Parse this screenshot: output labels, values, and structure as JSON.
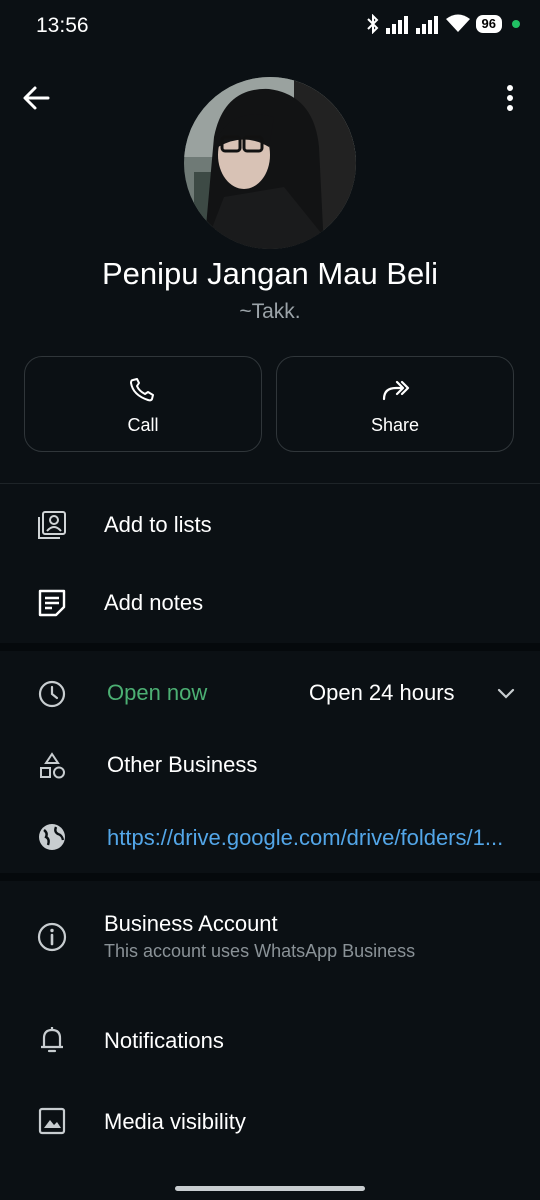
{
  "status_bar": {
    "time": "13:56",
    "battery": "96"
  },
  "profile": {
    "name": "Penipu Jangan Mau Beli",
    "about": "~Takk."
  },
  "actions": {
    "call_label": "Call",
    "share_label": "Share"
  },
  "menu": {
    "add_to_lists": "Add to lists",
    "add_notes": "Add notes"
  },
  "business": {
    "hours_status": "Open now",
    "hours_detail": "Open 24 hours",
    "category": "Other Business",
    "website": "https://drive.google.com/drive/folders/1...",
    "account_title": "Business Account",
    "account_subtitle": "This account uses WhatsApp Business"
  },
  "settings": {
    "notifications": "Notifications",
    "media_visibility": "Media visibility"
  },
  "colors": {
    "background": "#0b1014",
    "accent_green": "#4caf73",
    "link_blue": "#53a6e8",
    "status_dot": "#21c063"
  }
}
